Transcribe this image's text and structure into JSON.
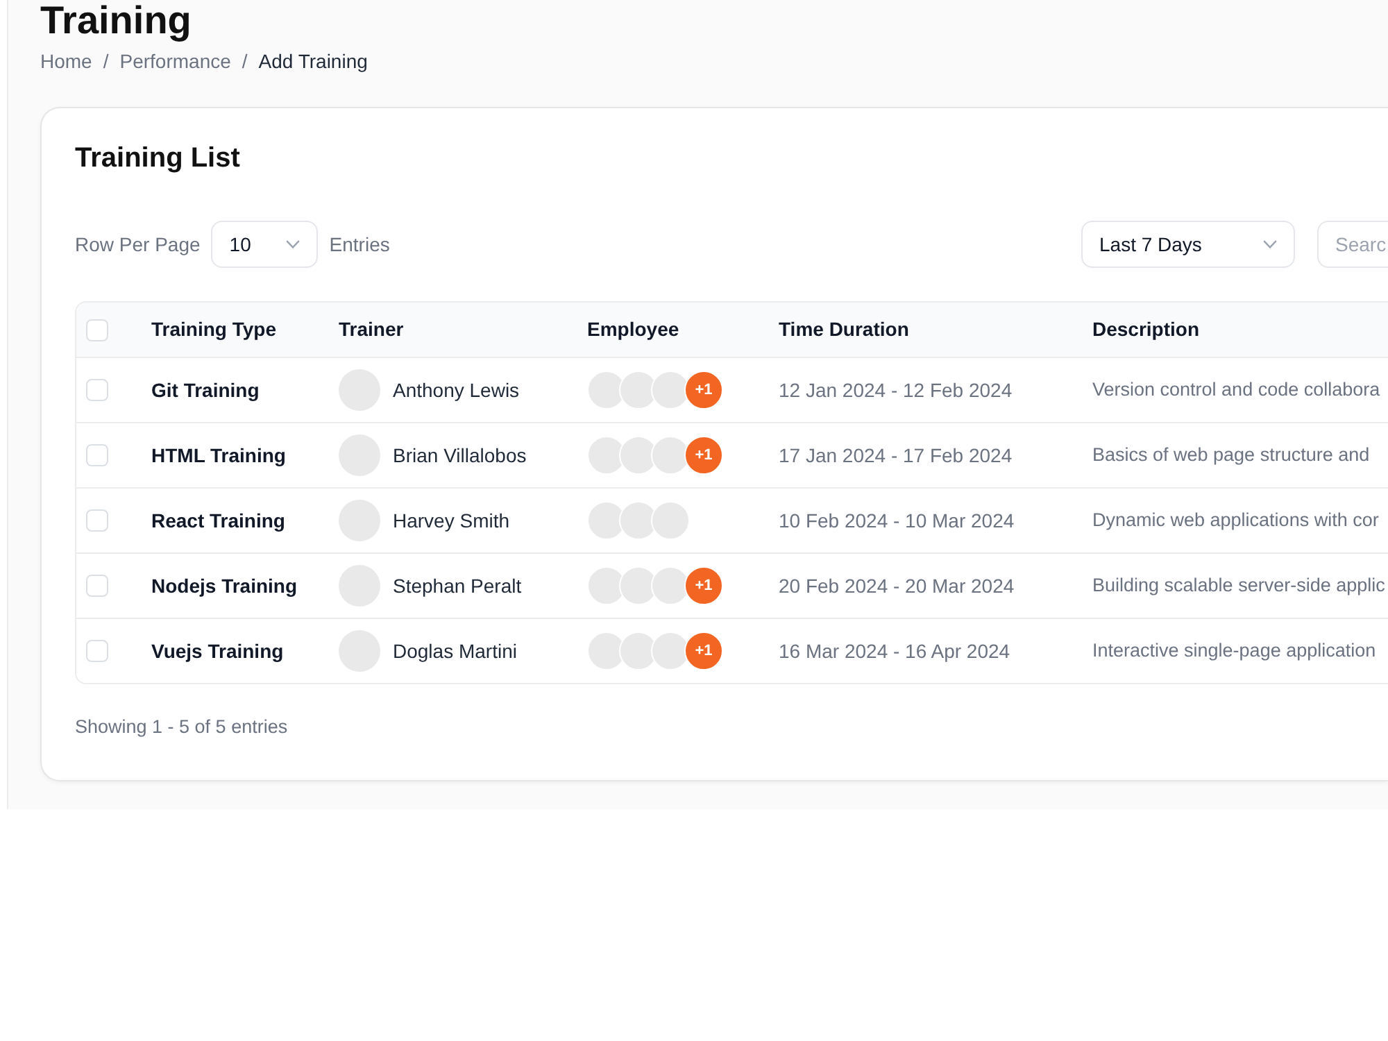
{
  "page": {
    "title": "Training",
    "breadcrumb": [
      {
        "kind": "link",
        "label": "Home"
      },
      {
        "kind": "separator",
        "label": "/"
      },
      {
        "kind": "link",
        "label": "Performance"
      },
      {
        "kind": "separator",
        "label": "/"
      },
      {
        "kind": "current",
        "label": "Add Training"
      }
    ]
  },
  "card": {
    "title": "Training List",
    "rows_per_page": {
      "label": "Row Per Page",
      "value": "10",
      "suffix": "Entries"
    },
    "date_filter": {
      "value": "Last 7 Days"
    },
    "search": {
      "placeholder": "Searc"
    },
    "table": {
      "select_all_checked": false,
      "columns": [
        "Training Type",
        "Trainer",
        "Employee",
        "Time Duration",
        "Description"
      ],
      "rows": [
        {
          "checked": false,
          "training_type": "Git Training",
          "trainer": "Anthony Lewis",
          "employees_more": "+1",
          "time_duration": "12 Jan 2024 - 12 Feb 2024",
          "description": "Version control and code collabora"
        },
        {
          "checked": false,
          "training_type": "HTML Training",
          "trainer": "Brian Villalobos",
          "employees_more": "+1",
          "time_duration": "17 Jan 2024 - 17 Feb 2024",
          "description": "Basics of web page structure and"
        },
        {
          "checked": false,
          "training_type": "React Training",
          "trainer": "Harvey Smith",
          "time_duration": "10 Feb 2024 - 10 Mar 2024",
          "description": "Dynamic web applications with cor"
        },
        {
          "checked": false,
          "training_type": "Nodejs Training",
          "trainer": "Stephan Peralt",
          "employees_more": "+1",
          "time_duration": "20 Feb 2024 - 20 Mar 2024",
          "description": "Building scalable server-side applic"
        },
        {
          "checked": false,
          "training_type": "Vuejs Training",
          "trainer": "Doglas Martini",
          "employees_more": "+1",
          "time_duration": "16 Mar 2024 - 16 Apr 2024",
          "description": "Interactive single-page application"
        }
      ]
    },
    "footer": "Showing 1 - 5 of 5 entries"
  }
}
